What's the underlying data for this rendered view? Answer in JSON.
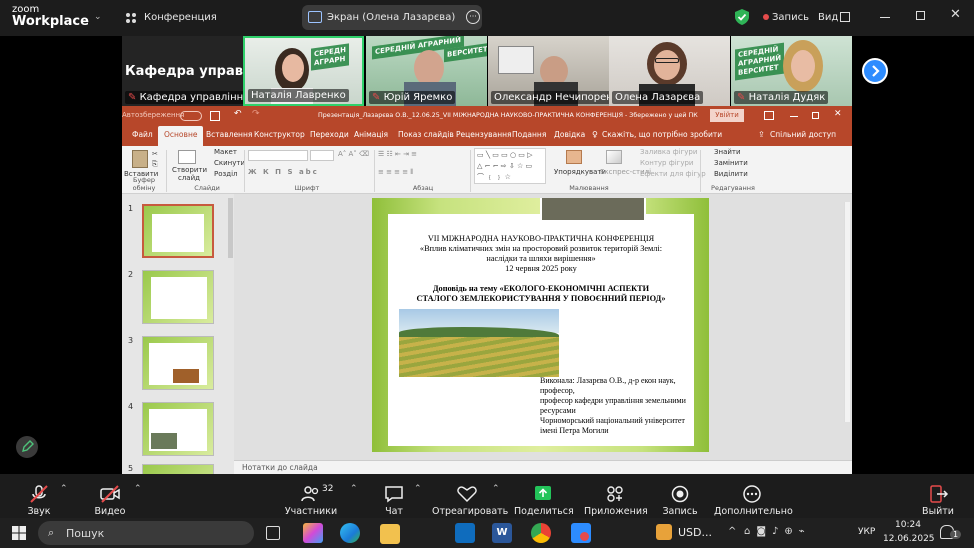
{
  "zoom": {
    "logo_line1": "zoom",
    "logo_line2": "Workplace",
    "meeting_name": "Конференция",
    "share_label": "Экран (Олена Лазарєва)",
    "record_label": "Запись",
    "view_label": "Вид"
  },
  "videos": {
    "first_tile_title": "Кафедра управ...",
    "tiles": [
      {
        "name": "Кафедра управління з..."
      },
      {
        "name": "Наталія Лавренко"
      },
      {
        "name": "Юрій Яремко"
      },
      {
        "name": "Олександр Нечипоренко"
      },
      {
        "name": "Олена Лазарєва"
      },
      {
        "name": "Наталія Дудяк"
      }
    ]
  },
  "ppt": {
    "autosave": "Автозбереження",
    "file_title": "Презентація_Лазарєва О.В._12.06.25_VII МІЖНАРОДНА НАУКОВО-ПРАКТИЧНА КОНФЕРЕНЦІЯ - Збережено у цей ПК",
    "login": "Увійти",
    "tabs": [
      "Файл",
      "Основне",
      "Вставлення",
      "Конструктор",
      "Переходи",
      "Анімація",
      "Показ слайдів",
      "Рецензування",
      "Подання",
      "Довідка"
    ],
    "tell_me": "Скажіть, що потрібно зробити",
    "share": "Спільний доступ",
    "ribbon": {
      "paste": "Вставити",
      "new_slide": "Створити слайд",
      "layout": "Макет",
      "reset": "Скинути",
      "section": "Розділ",
      "find": "Знайти",
      "replace": "Замінити",
      "select": "Виділити",
      "arrange": "Упорядкувати",
      "quick_styles": "Експрес-стилі",
      "fill": "Заливка фігури",
      "outline": "Контур фігури",
      "effects": "Ефекти для фігур",
      "groups": [
        "Буфер обміну",
        "Слайди",
        "Шрифт",
        "Абзац",
        "Малювання",
        "Редагування"
      ]
    },
    "slide_numbers": [
      "1",
      "2",
      "3",
      "4",
      "5"
    ],
    "notes": "Нотатки до слайда",
    "slide": {
      "line1": "VII МІЖНАРОДНА НАУКОВО-ПРАКТИЧНА КОНФЕРЕНЦІЯ",
      "line2": "«Вплив кліматичних змін на просторовий розвиток територій Землі:",
      "line3": "наслідки та шляхи вирішення»",
      "line4": "12 червня 2025 року",
      "line5": "Доповідь на тему «ЕКОЛОГО-ЕКОНОМІЧНІ АСПЕКТИ",
      "line6": "СТАЛОГО ЗЕМЛЕКОРИСТУВАННЯ У ПОВОЄННИЙ ПЕРІОД»",
      "author1": "Виконала: Лазарєва О.В., д-р екон наук,",
      "author2": "професор,",
      "author3": "професор кафедри управління земельними",
      "author4": "ресурсами",
      "author5": "Чорноморський національний університет",
      "author6": "імені Петра Могили"
    }
  },
  "toolbar": {
    "audio": "Звук",
    "video": "Видео",
    "participants": "Участники",
    "participants_count": "32",
    "chat": "Чат",
    "react": "Отреагировать",
    "share": "Поделиться",
    "apps": "Приложения",
    "record": "Запись",
    "more": "Дополнительно",
    "leave": "Выйти"
  },
  "taskbar": {
    "search": "Пошук",
    "currency": "USD...",
    "lang": "УКР",
    "time": "10:24",
    "date": "12.06.2025",
    "notif_count": "1"
  }
}
